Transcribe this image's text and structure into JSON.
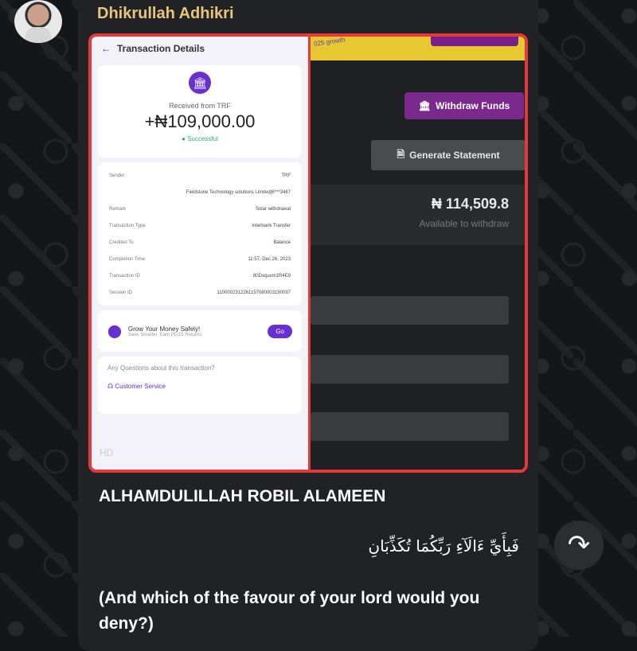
{
  "sender": "Dhikrullah Adhikri",
  "screenshot": {
    "left": {
      "title": "Transaction Details",
      "received_label": "Received from TRF",
      "amount": "+₦109,000.00",
      "status": "Successful",
      "details": [
        {
          "label": "Sender",
          "value": "TRF"
        },
        {
          "label": "",
          "value": "Fieldstone Technology solutions Limited|6***3467"
        },
        {
          "label": "Remark",
          "value": "Solar withdrawal"
        },
        {
          "label": "Transaction Type",
          "value": "Interbank Transfer"
        },
        {
          "label": "Credited To",
          "value": "Balance"
        },
        {
          "label": "Completion Time",
          "value": "11:57, Dec 26, 2023"
        },
        {
          "label": "Transaction ID",
          "value": "80Dxquxm1R4E9"
        },
        {
          "label": "Session ID",
          "value": "1100002312261157080003190097"
        }
      ],
      "promo_title": "Grow Your Money Safely!",
      "promo_sub": "Save Smarter, Earn PLUS Returns",
      "go_label": "Go",
      "question": "Any Questions about this transaction?",
      "support": "Customer Service",
      "hd": "HD"
    },
    "right": {
      "banner_text": "025 growth",
      "withdraw_label": "Withdraw Funds",
      "statement_label": "Generate Statement",
      "balance": "₦ 114,509.8",
      "balance_label": "Available to withdraw"
    }
  },
  "caption": "ALHAMDULILLAH ROBIL ALAMEEN",
  "arabic": "فَبِأَيِّ ءَالَآءِ رَبِّكُمَا تُكَذِّبَانِ",
  "translation": "(And which of the favour of your lord would you deny?)",
  "icons": {
    "forward": "forward-icon",
    "bank": "bank-icon",
    "location": "location-pin-icon",
    "back": "back-arrow-icon",
    "support": "headset-icon",
    "document": "document-icon"
  }
}
